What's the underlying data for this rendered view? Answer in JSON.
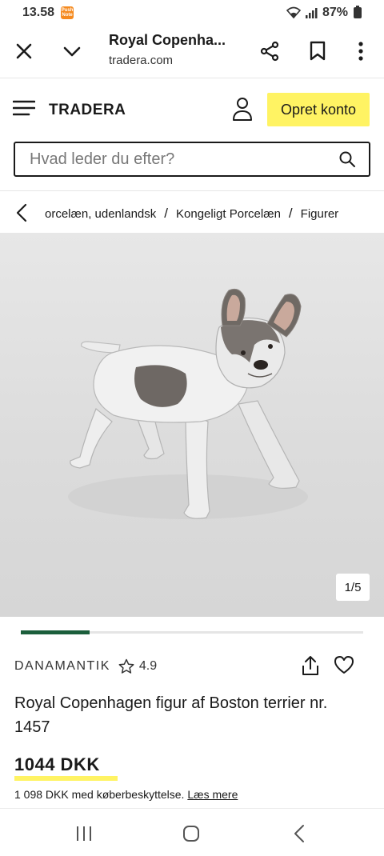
{
  "status_bar": {
    "time": "13.58",
    "notif_label": "Push Note",
    "battery": "87%",
    "icons": [
      "wifi-icon",
      "signal-icon",
      "battery-icon"
    ]
  },
  "browser": {
    "title": "Royal Copenha...",
    "url": "tradera.com",
    "icons": [
      "close-icon",
      "chevron-down-icon",
      "share-icon",
      "bookmark-icon",
      "more-icon"
    ]
  },
  "header": {
    "logo": "TRADERA",
    "signup_label": "Opret konto",
    "signup_color": "#fff363"
  },
  "search": {
    "placeholder": "Hvad leder du efter?"
  },
  "breadcrumb": {
    "items": [
      "orcelæn, udenlandsk",
      "Kongeligt Porcelæn",
      "Figurer"
    ],
    "separator": "/"
  },
  "gallery": {
    "counter": "1/5",
    "current": 1,
    "total": 5,
    "progress_fraction": 0.2,
    "progress_color": "#1b5e3b"
  },
  "seller": {
    "name": "DANAMANTIK",
    "rating": "4.9"
  },
  "product": {
    "title": "Royal Copenhagen figur af Boston terrier nr. 1457",
    "price": "1044 DKK",
    "protection_text": "1 098 DKK med køberbeskyttelse.",
    "protection_link": "Læs mere"
  },
  "nav": {
    "icons": [
      "recent-apps-icon",
      "home-icon",
      "back-icon"
    ]
  }
}
